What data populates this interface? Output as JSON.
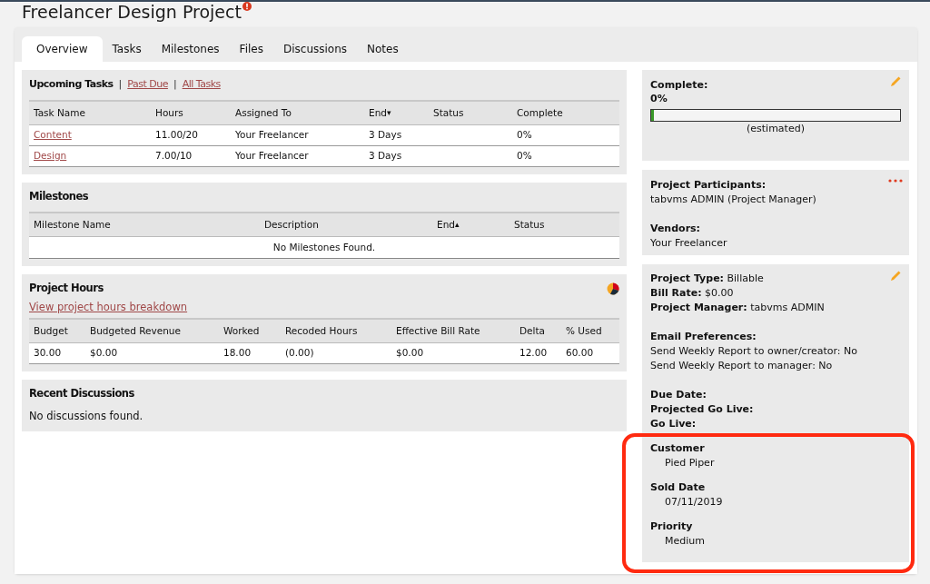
{
  "page": {
    "title": "Freelancer Design Project"
  },
  "tabs": [
    {
      "label": "Overview",
      "selected": true
    },
    {
      "label": "Tasks",
      "selected": false
    },
    {
      "label": "Milestones",
      "selected": false
    },
    {
      "label": "Files",
      "selected": false
    },
    {
      "label": "Discussions",
      "selected": false
    },
    {
      "label": "Notes",
      "selected": false
    }
  ],
  "upcoming_tasks": {
    "filters": [
      {
        "label": "Upcoming Tasks",
        "selected": true
      },
      {
        "separator": "|",
        "label": "Past Due",
        "selected": false
      },
      {
        "separator": "|",
        "label": "All Tasks",
        "selected": false
      }
    ],
    "columns": [
      {
        "label": "Task Name"
      },
      {
        "label": "Hours"
      },
      {
        "label": "Assigned To"
      },
      {
        "label": "End",
        "sort_glyph": "▾"
      },
      {
        "label": "Status"
      },
      {
        "label": "Complete"
      }
    ],
    "rows": [
      [
        "Content",
        "11.00/20",
        "Your Freelancer",
        "3 Days",
        "",
        "0%"
      ],
      [
        "Design",
        "7.00/10",
        "Your Freelancer",
        "3 Days",
        "",
        "0%"
      ]
    ]
  },
  "milestones": {
    "title": "Milestones",
    "columns": [
      {
        "label": "Milestone Name"
      },
      {
        "label": "Description"
      },
      {
        "label": "End",
        "sort_glyph": "▴"
      },
      {
        "label": "Status"
      }
    ],
    "empty_message": "No Milestones Found."
  },
  "project_hours": {
    "title": "Project Hours",
    "link": "View project hours breakdown",
    "columns": [
      {
        "label": "Budget"
      },
      {
        "label": "Budgeted Revenue"
      },
      {
        "label": "Worked"
      },
      {
        "label": "Recoded Hours"
      },
      {
        "label": "Effective Bill Rate"
      },
      {
        "label": "Delta"
      },
      {
        "label": "% Used"
      }
    ],
    "rows": [
      [
        "30.00",
        "$0.00",
        "18.00",
        "(0.00)",
        "$0.00",
        "12.00",
        "60.00"
      ]
    ]
  },
  "discussions": {
    "title": "Recent Discussions",
    "empty_message": "No discussions found."
  },
  "completion": {
    "label": "Complete:",
    "value": "0%",
    "level": 0,
    "note": "(estimated)"
  },
  "participants": {
    "groups": [
      {
        "label": "Project Participants:",
        "value": "tabvms ADMIN (Project Manager)"
      },
      {
        "label": "Vendors:",
        "value": "Your Freelancer"
      }
    ]
  },
  "details": {
    "groups": [
      [
        {
          "label": "Project Type:",
          "value": "Billable"
        },
        {
          "label": "Bill Rate:",
          "value": "$0.00"
        },
        {
          "label": "Project Manager:",
          "value": "tabvms ADMIN"
        }
      ],
      [
        {
          "label": "Email Preferences:"
        },
        {
          "value": "Send Weekly Report to owner/creator: No"
        },
        {
          "value": "Send Weekly Report to manager: No"
        }
      ],
      [
        {
          "label": "Due Date:"
        },
        {
          "label": "Projected Go Live:"
        },
        {
          "label": "Go Live:"
        }
      ]
    ]
  },
  "custom_fields": {
    "highlighted": true,
    "fields": [
      {
        "label": "Customer",
        "value": "Pied Piper"
      },
      {
        "label": "Sold Date",
        "value": "07/11/2019"
      },
      {
        "label": "Priority",
        "value": "Medium"
      }
    ]
  }
}
